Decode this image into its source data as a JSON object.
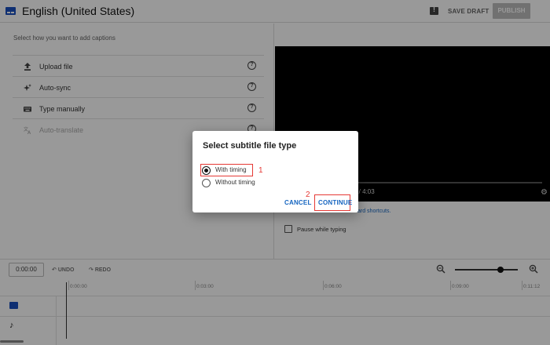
{
  "header": {
    "title": "English (United States)",
    "save_draft": "SAVE DRAFT",
    "publish": "PUBLISH",
    "icon": "subtitles-icon",
    "feedback_icon": "feedback-icon"
  },
  "left_panel": {
    "instruction": "Select how you want to add captions",
    "options": [
      {
        "label": "Upload file",
        "icon": "upload-icon"
      },
      {
        "label": "Auto-sync",
        "icon": "sparkle-icon"
      },
      {
        "label": "Type manually",
        "icon": "keyboard-icon"
      },
      {
        "label": "Auto-translate",
        "icon": "translate-icon",
        "disabled": true
      }
    ],
    "help_glyph": "?"
  },
  "video": {
    "time_fragment": "0 / 4:03",
    "keyboard_link_fragment": "ard shortcuts.",
    "pause_label": "Pause while typing"
  },
  "timeline": {
    "timecode": "0:00:00",
    "undo": "UNDO",
    "redo": "REDO",
    "ticks": [
      "0:00:00",
      "0:03:00",
      "0:06:00",
      "0:09:00",
      "0:11:12"
    ],
    "zoom_level": 0.72
  },
  "dialog": {
    "title": "Select subtitle file type",
    "options": [
      {
        "label": "With timing",
        "checked": true
      },
      {
        "label": "Without timing",
        "checked": false
      }
    ],
    "cancel": "CANCEL",
    "continue": "CONTINUE",
    "annotations": [
      "1",
      "2"
    ]
  },
  "colors": {
    "accent_blue": "#1565c0",
    "highlight_red": "#e53935",
    "scrim": "rgba(0,0,0,0.4)"
  }
}
